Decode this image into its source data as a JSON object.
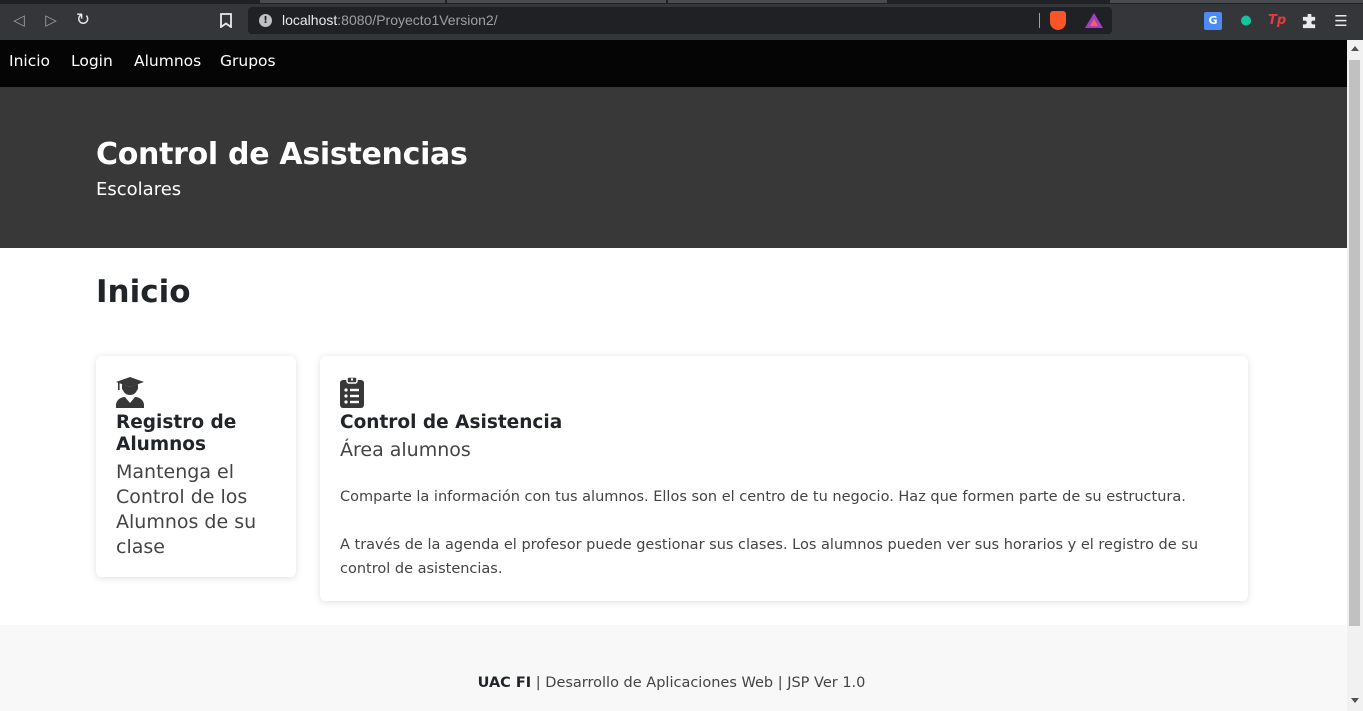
{
  "browser": {
    "url_host": "localhost",
    "url_path": ":8080/Proyecto1Version2/",
    "back_icon": "back-arrow-icon",
    "forward_icon": "forward-arrow-icon",
    "reload_icon": "reload-icon",
    "bookmark_icon": "bookmark-icon",
    "extensions": [
      "translate-icon",
      "grammarly-icon",
      "tp-icon",
      "puzzle-icon",
      "menu-icon"
    ],
    "tp_label": "Tp"
  },
  "nav": {
    "items": [
      "Inicio",
      "Login",
      "Alumnos",
      "Grupos"
    ]
  },
  "hero": {
    "title": "Control de Asistencias",
    "subtitle": "Escolares"
  },
  "main": {
    "section_title": "Inicio",
    "card_left": {
      "icon": "graduate-user-icon",
      "heading": "Registro de Alumnos",
      "description": "Mantenga el Control de los Alumnos de su clase"
    },
    "card_right": {
      "icon": "clipboard-list-icon",
      "heading": "Control de Asistencia",
      "subheading": "Área alumnos",
      "paragraph_1": "Comparte la información con tus alumnos. Ellos son el centro de tu negocio. Haz que formen parte de su estructura.",
      "paragraph_2": "A través de la agenda el profesor puede gestionar sus clases. Los alumnos pueden ver sus horarios y el registro de su control de asistencias."
    }
  },
  "footer": {
    "brand": "UAC FI",
    "text": " | Desarrollo de Aplicaciones Web | JSP Ver 1.0"
  }
}
